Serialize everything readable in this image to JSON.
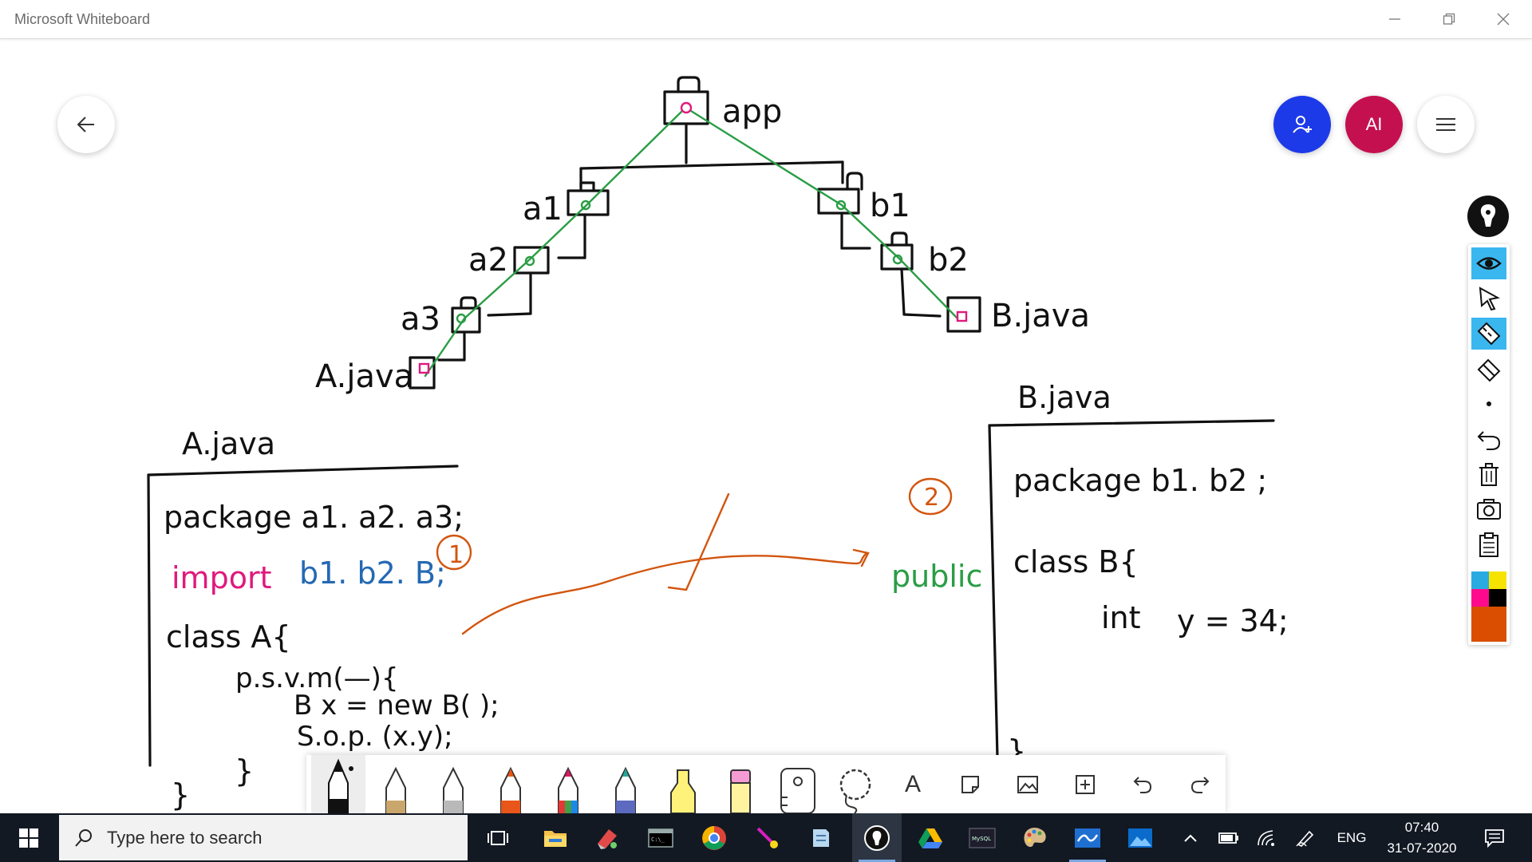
{
  "window": {
    "title": "Microsoft Whiteboard"
  },
  "header": {
    "account_initials": "AI"
  },
  "board": {
    "tree": {
      "root": "app",
      "left": [
        "a1",
        "a2",
        "a3"
      ],
      "right": [
        "b1",
        "b2"
      ],
      "left_file": "A.java",
      "right_file": "B.java"
    },
    "a_java": {
      "title": "A.java",
      "lines": [
        "package  a1. a2. a3;",
        "import",
        "b1. b2. B;",
        "class  A{",
        "p.s.v.m(—){",
        "B  x = new  B( );",
        "S.o.p. (x.y);",
        "}",
        "}"
      ],
      "markers": [
        "1",
        "2"
      ]
    },
    "b_java": {
      "title": "B.java",
      "lines": [
        "package   b1. b2 ;",
        "class  B{",
        "int",
        "y = 34;",
        "}"
      ]
    },
    "annotation_word": "public"
  },
  "side_toolbar": {
    "tools": [
      "eye-icon",
      "select-icon",
      "ruler-icon",
      "eraser-icon",
      "dot-icon",
      "undo-icon",
      "trash-icon",
      "camera-icon",
      "clipboard-icon"
    ],
    "colors": [
      "#29abe2",
      "#f7e300",
      "#ff0a8c",
      "#000000",
      "#d94e00"
    ]
  },
  "pen_toolbar": {
    "tools": [
      "black-pen",
      "gold-pen",
      "silver-pen",
      "orange-pen",
      "rainbow-pen",
      "galaxy-pen",
      "yellow-highlighter",
      "pink-highlighter",
      "ruler-tool",
      "lasso-tool",
      "text-tool",
      "note-tool",
      "image-tool",
      "add-tool",
      "undo-tool",
      "redo-tool"
    ],
    "text_glyph": "A"
  },
  "taskbar": {
    "search_placeholder": "Type here to search",
    "language": "ENG",
    "time": "07:40",
    "date": "31-07-2020"
  }
}
